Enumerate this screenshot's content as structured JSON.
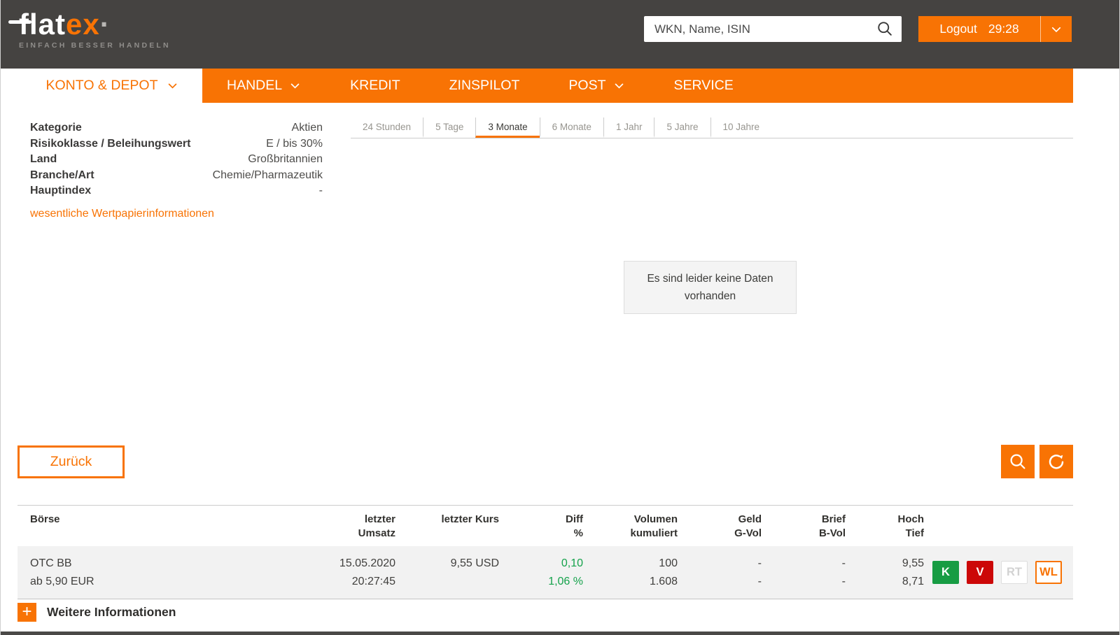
{
  "colors": {
    "accent": "#f87304",
    "header-bg": "#454341",
    "green": "#15a24b",
    "red": "#cc0808",
    "buy": "#179c43"
  },
  "header": {
    "logo": {
      "part1": "flat",
      "part2": "ex",
      "dot": "·",
      "tagline": "EINFACH BESSER HANDELN"
    },
    "search": {
      "placeholder": "WKN, Name, ISIN"
    },
    "logout": {
      "label": "Logout",
      "timer": "29:28"
    }
  },
  "nav": {
    "items": [
      {
        "label": "KONTO & DEPOT"
      },
      {
        "label": "HANDEL"
      },
      {
        "label": "KREDIT"
      },
      {
        "label": "ZINSPILOT"
      },
      {
        "label": "POST"
      },
      {
        "label": "SERVICE"
      }
    ]
  },
  "instrument_info": {
    "rows": [
      {
        "label": "Kategorie",
        "value": "Aktien"
      },
      {
        "label": "Risikoklasse / Beleihungswert",
        "value": "E / bis 30%"
      },
      {
        "label": "Land",
        "value": "Großbritannien"
      },
      {
        "label": "Branche/Art",
        "value": "Chemie/Pharmazeutik"
      },
      {
        "label": "Hauptindex",
        "value": "-"
      }
    ],
    "link": "wesentliche Wertpapierinformationen"
  },
  "chart": {
    "period_tabs": [
      "24 Stunden",
      "5 Tage",
      "3 Monate",
      "6 Monate",
      "1 Jahr",
      "5 Jahre",
      "10 Jahre"
    ],
    "active_tab": "3 Monate",
    "no_data_message": "Es sind leider keine Daten vorhanden"
  },
  "actions": {
    "back_label": "Zurück"
  },
  "quotes_table": {
    "columns": [
      {
        "l1": "Börse",
        "l2": ""
      },
      {
        "l1": "letzter",
        "l2": "Umsatz"
      },
      {
        "l1": "letzter Kurs",
        "l2": ""
      },
      {
        "l1": "Diff",
        "l2": "%"
      },
      {
        "l1": "Volumen",
        "l2": "kumuliert"
      },
      {
        "l1": "Geld",
        "l2": "G-Vol"
      },
      {
        "l1": "Brief",
        "l2": "B-Vol"
      },
      {
        "l1": "Hoch",
        "l2": "Tief"
      }
    ],
    "rows": [
      {
        "boerse": [
          "OTC BB",
          "ab 5,90 EUR"
        ],
        "letzter_umsatz": [
          "15.05.2020",
          "20:27:45"
        ],
        "letzter_kurs": "9,55 USD",
        "diff": [
          "0,10",
          "1,06 %"
        ],
        "volumen": [
          "100",
          "1.608"
        ],
        "geld": [
          "-",
          "-"
        ],
        "brief": [
          "-",
          "-"
        ],
        "hoch_tief": [
          "9,55",
          "8,71"
        ],
        "buttons": [
          {
            "label": "K"
          },
          {
            "label": "V"
          },
          {
            "label": "RT"
          },
          {
            "label": "WL"
          }
        ]
      }
    ]
  },
  "footer": {
    "more_info_label": "Weitere Informationen"
  }
}
